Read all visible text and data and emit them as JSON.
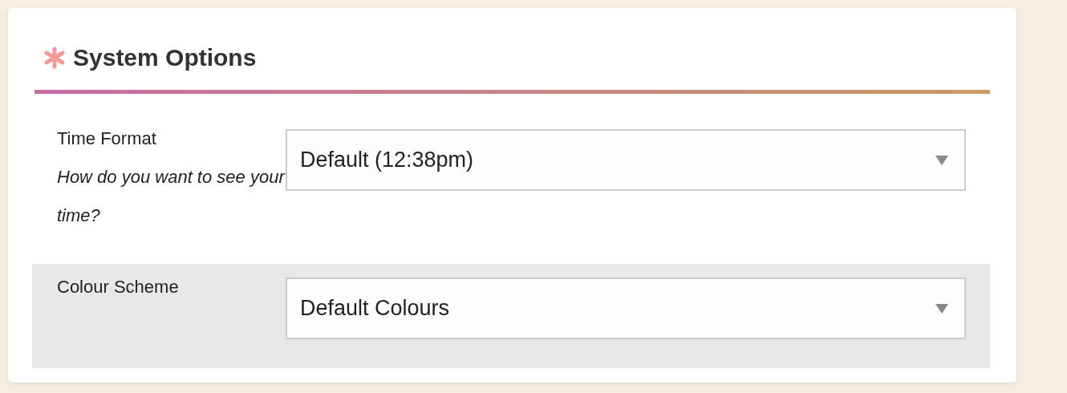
{
  "panel": {
    "title": "System Options"
  },
  "options": [
    {
      "label": "Time Format",
      "hint": "How do you want to see your time?",
      "value": "Default (12:38pm)"
    },
    {
      "label": "Colour Scheme",
      "value": "Default Colours"
    }
  ]
}
